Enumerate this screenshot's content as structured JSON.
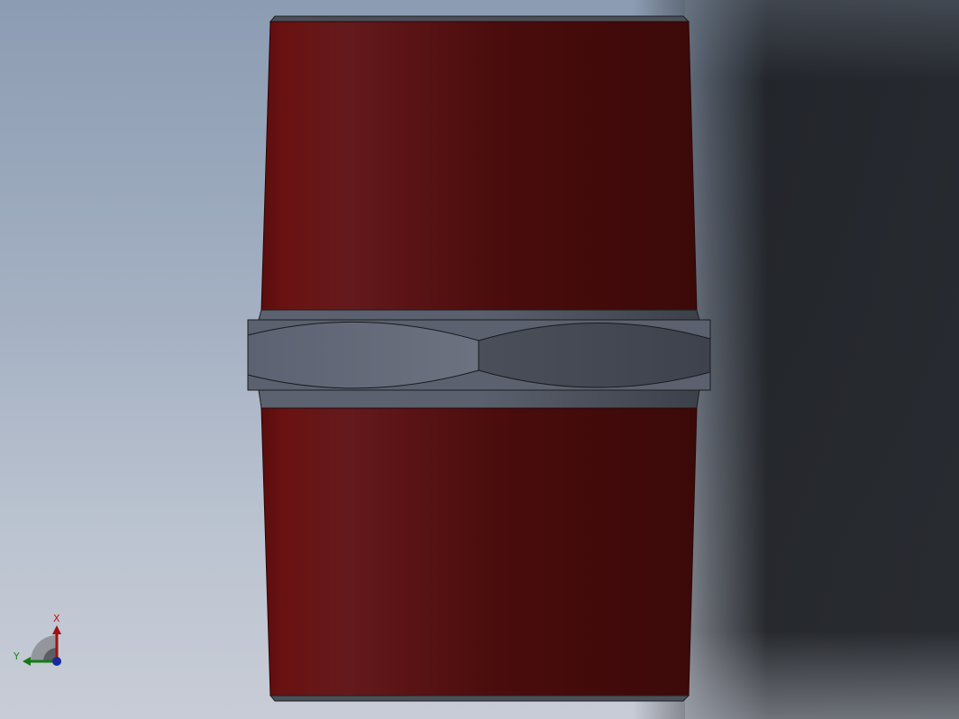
{
  "viewport": {
    "colors": {
      "background_top": "#8c9cb2",
      "background_bottom": "#c8ccd6",
      "part_red": "#5e0e0e",
      "hex_steel": "#6a707c"
    }
  },
  "model": {
    "parts": [
      "upper-pipe-thread",
      "hex-nut",
      "lower-pipe-thread"
    ]
  },
  "triad": {
    "x_label": "X",
    "y_label": "Y"
  }
}
